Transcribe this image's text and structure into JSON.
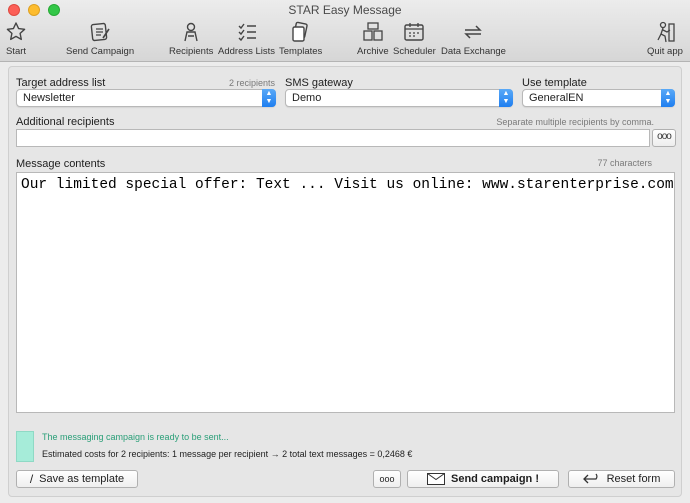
{
  "window": {
    "title": "STAR Easy Message"
  },
  "toolbar": {
    "start": "Start",
    "send_campaign": "Send Campaign",
    "recipients": "Recipients",
    "address_lists": "Address Lists",
    "templates": "Templates",
    "archive": "Archive",
    "scheduler": "Scheduler",
    "data_exchange": "Data Exchange",
    "quit": "Quit app"
  },
  "form": {
    "target_label": "Target address list",
    "target_count": "2 recipients",
    "target_value": "Newsletter",
    "gateway_label": "SMS gateway",
    "gateway_value": "Demo",
    "template_label": "Use template",
    "template_value": "GeneralEN",
    "additional_label": "Additional recipients",
    "additional_hint": "Separate multiple recipients by comma.",
    "additional_value": "",
    "message_label": "Message contents",
    "message_count": "77 characters",
    "message_text": "Our limited special offer: Text ... Visit us online: www.starenterprise.com !"
  },
  "status": {
    "ready": "The messaging campaign is ready to be sent...",
    "cost": "Estimated costs for 2 recipients: 1 message per recipient → 2 total text messages = 0,2468 €",
    "swatch_color": "#a6ecd9"
  },
  "buttons": {
    "save_template": "Save as template",
    "more": "ooo",
    "send": "Send campaign !",
    "reset": "Reset form"
  }
}
